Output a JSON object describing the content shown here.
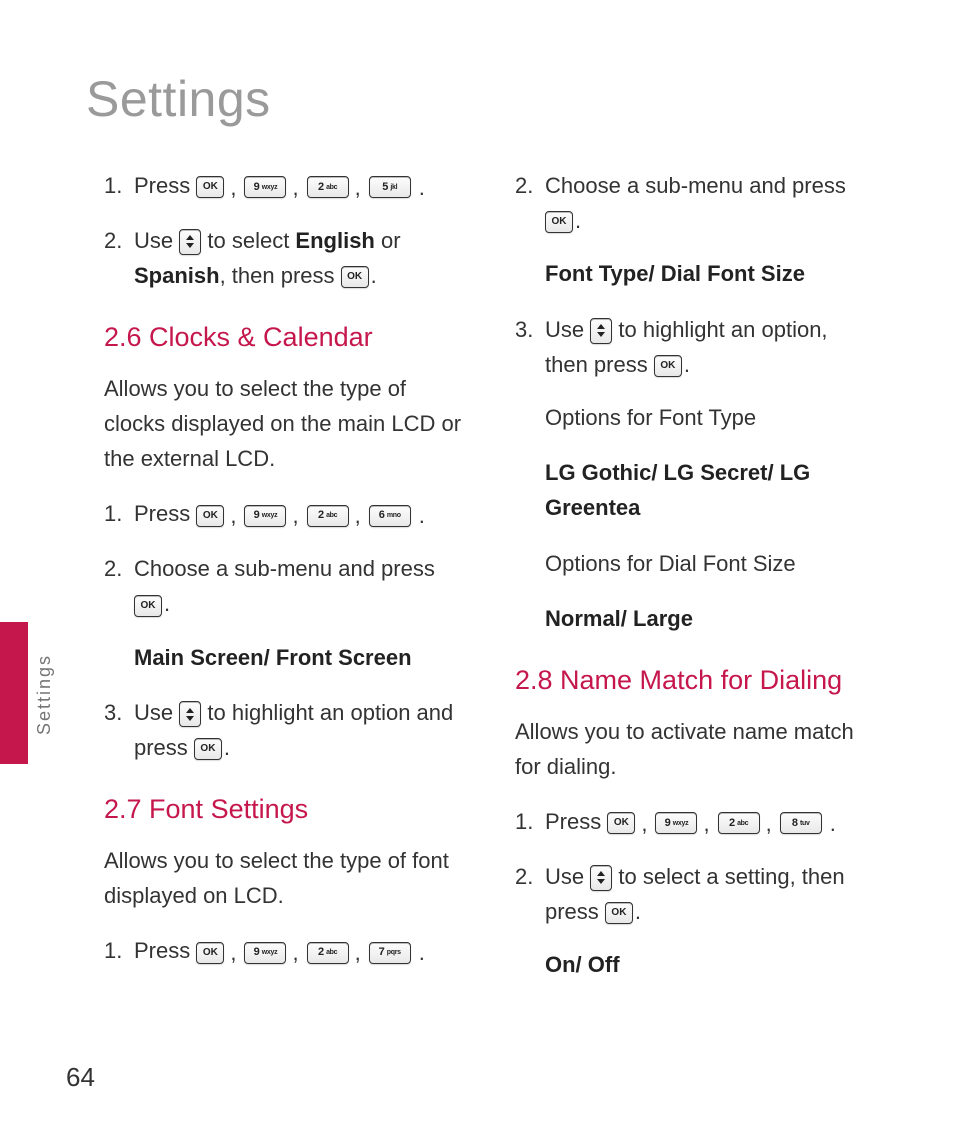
{
  "pageTitle": "Settings",
  "sideLabel": "Settings",
  "pageNumber": "64",
  "keys": {
    "ok": "OK",
    "k9": {
      "n": "9",
      "l": "wxyz"
    },
    "k2": {
      "n": "2",
      "l": "abc"
    },
    "k5": {
      "n": "5",
      "l": "jkl"
    },
    "k6": {
      "n": "6",
      "l": "mno"
    },
    "k7": {
      "n": "7",
      "l": "pqrs"
    },
    "k8": {
      "n": "8",
      "l": "tuv"
    }
  },
  "left": {
    "s1": {
      "num": "1.",
      "pre": "Press "
    },
    "s2": {
      "num": "2.",
      "pre": "Use ",
      "mid": " to select ",
      "english": "English",
      "or": " or ",
      "spanish": "Spanish",
      "post": ", then press "
    },
    "h26": "2.6 Clocks & Calendar",
    "d26": "Allows you to select the type of clocks displayed on the main LCD or the external LCD.",
    "s26_1": {
      "num": "1.",
      "pre": "Press "
    },
    "s26_2": {
      "num": "2.",
      "txt": "Choose a sub-menu and press"
    },
    "mainfront": "Main Screen/ Front Screen",
    "s26_3": {
      "num": "3.",
      "pre": "Use ",
      "mid": " to highlight an option and press "
    },
    "h27": "2.7 Font Settings",
    "d27": "Allows you to select the type of font displayed on LCD.",
    "s27_1": {
      "num": "1.",
      "pre": "Press "
    }
  },
  "right": {
    "s2": {
      "num": "2.",
      "txt": "Choose a sub-menu and press"
    },
    "fonttype": "Font Type/ Dial Font Size",
    "s3": {
      "num": "3.",
      "pre": "Use ",
      "mid": " to highlight an option, then press "
    },
    "optFT": "Options for Font Type",
    "fonts": "LG Gothic/ LG Secret/ LG Greentea",
    "optDF": "Options for Dial Font Size",
    "sizes": "Normal/ Large",
    "h28": "2.8 Name Match for Dialing",
    "d28": "Allows you to activate name match for dialing.",
    "s28_1": {
      "num": "1.",
      "pre": "Press "
    },
    "s28_2": {
      "num": "2.",
      "pre": "Use ",
      "mid": " to select a setting, then press "
    },
    "onoff": "On/ Off"
  }
}
